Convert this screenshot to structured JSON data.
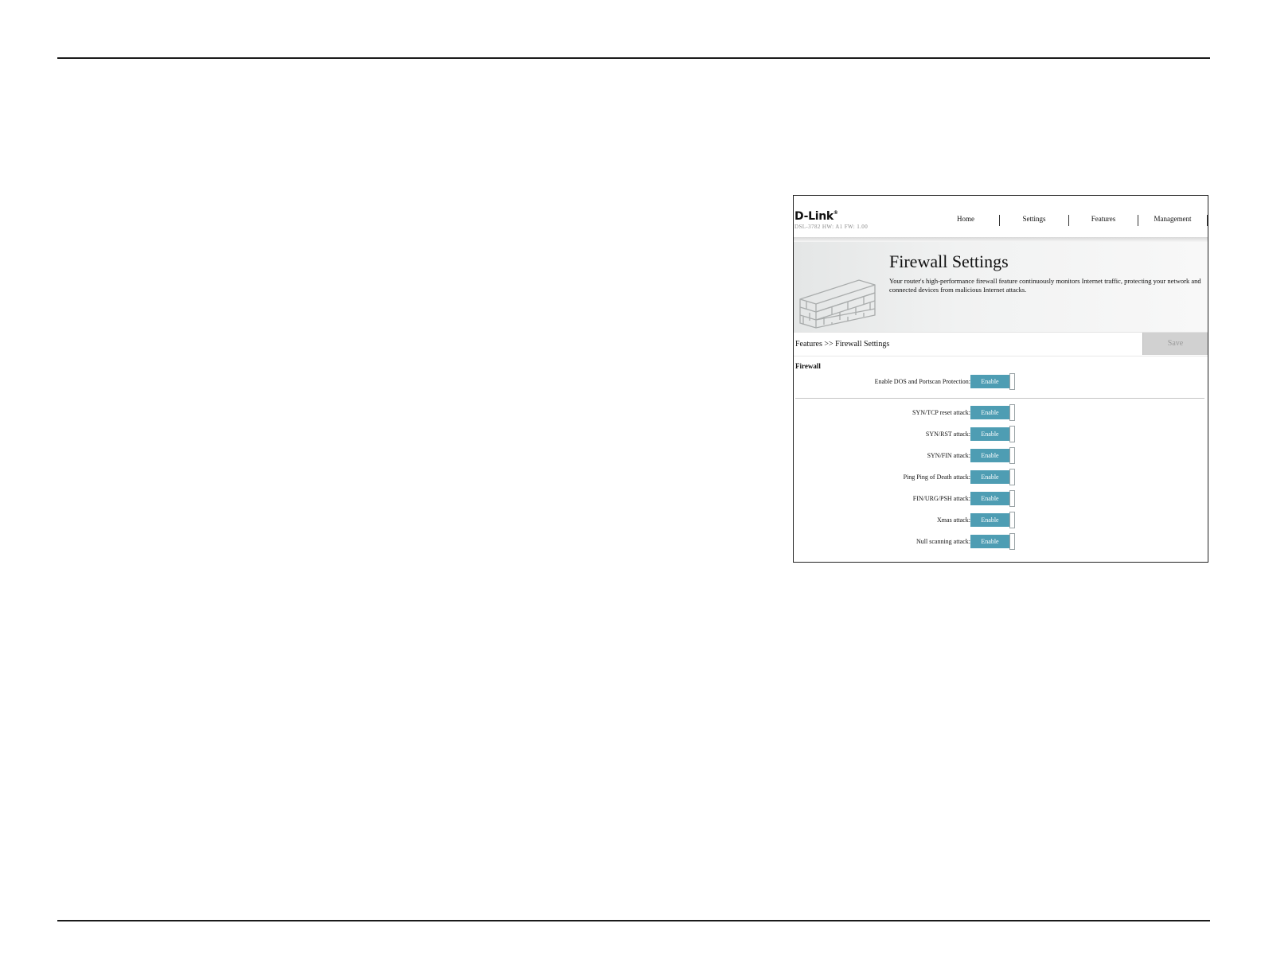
{
  "router_ui": {
    "brand": "D-Link",
    "model_info": "DSL-3782  HW: A1  FW: 1.00",
    "nav": [
      "Home",
      "Settings",
      "Features",
      "Management"
    ],
    "banner": {
      "title": "Firewall Settings",
      "description": "Your router's high-performance firewall feature continuously monitors Internet traffic, protecting your network and connected devices from malicious Internet attacks."
    },
    "breadcrumb": "Features >> Firewall Settings",
    "save_label": "Save",
    "section_title": "Firewall",
    "dos_protection": {
      "label": "Enable DOS and Portscan Protection:",
      "state": "Enable"
    },
    "attacks": [
      {
        "label": "SYN/TCP reset attack:",
        "state": "Enable"
      },
      {
        "label": "SYN/RST attack:",
        "state": "Enable"
      },
      {
        "label": "SYN/FIN attack:",
        "state": "Enable"
      },
      {
        "label": "Ping Ping of Death attack:",
        "state": "Enable"
      },
      {
        "label": "FIN/URG/PSH attack:",
        "state": "Enable"
      },
      {
        "label": "Xmas attack:",
        "state": "Enable"
      },
      {
        "label": "Null scanning attack:",
        "state": "Enable"
      }
    ],
    "colors": {
      "toggle_on": "#4e9db3",
      "save_disabled": "#d1d1d1"
    }
  }
}
